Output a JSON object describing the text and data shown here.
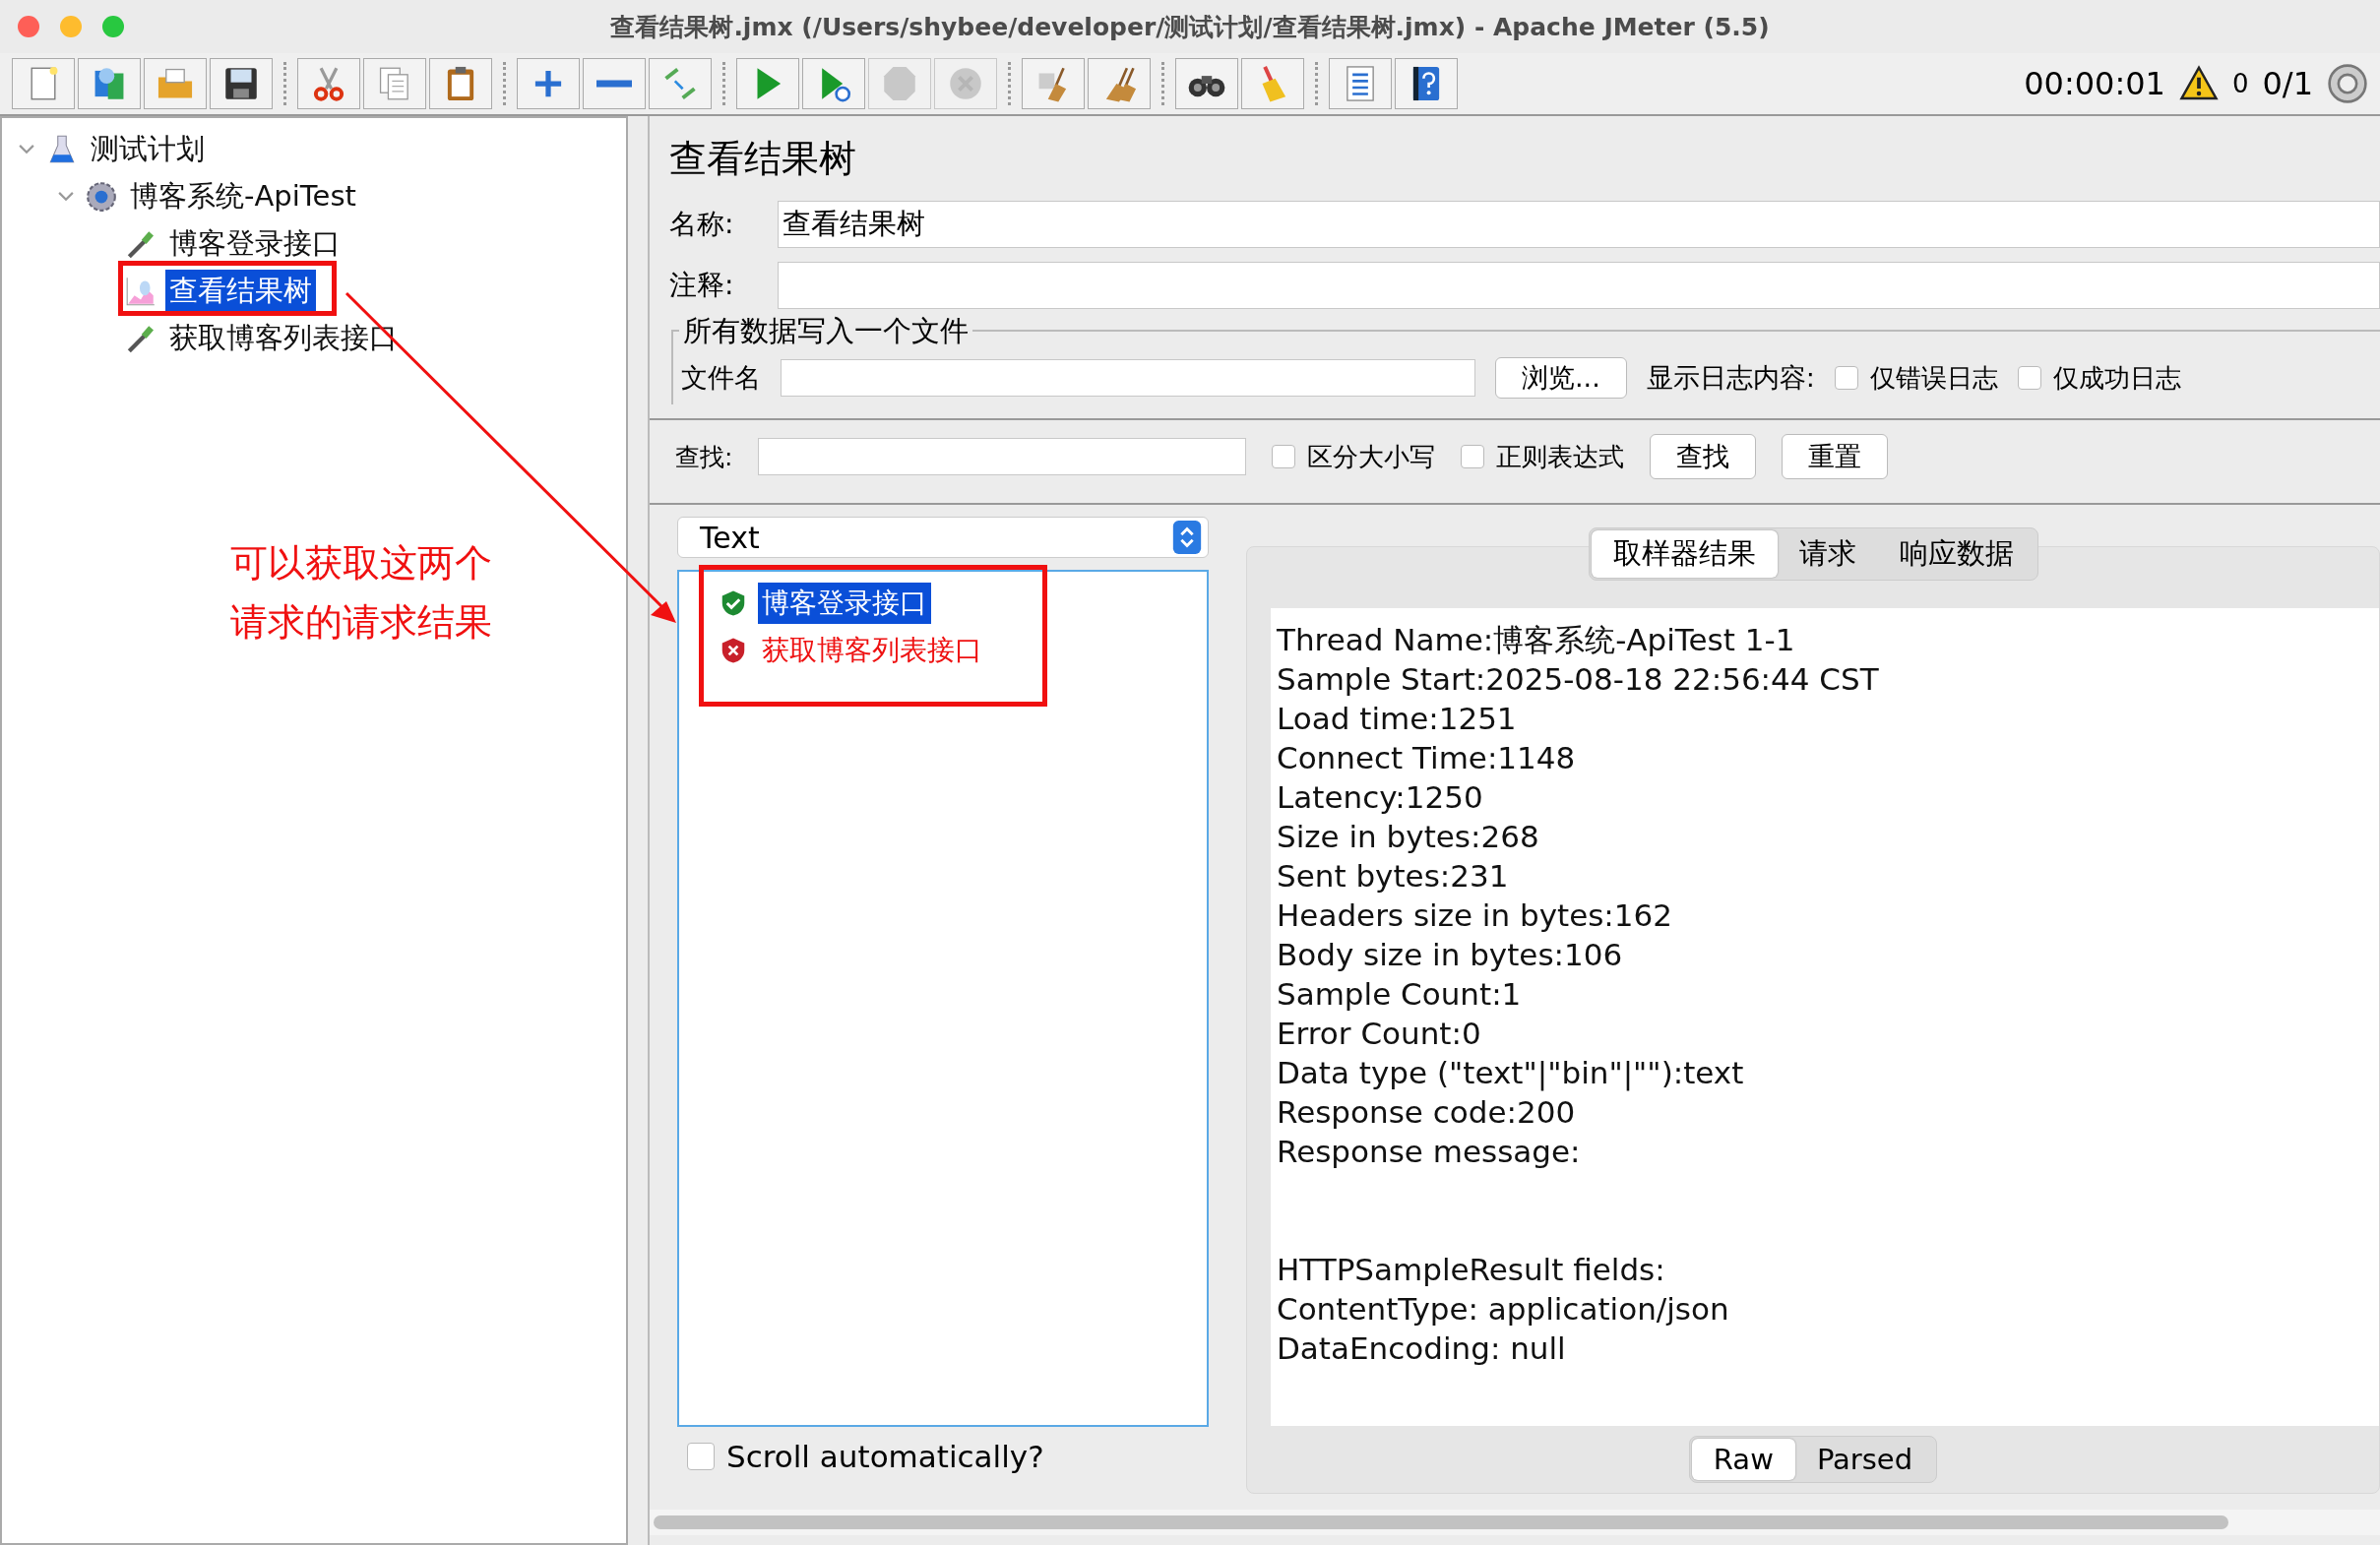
{
  "window": {
    "title": "查看结果树.jmx (/Users/shybee/developer/测试计划/查看结果树.jmx) - Apache JMeter (5.5)"
  },
  "toolbar": [
    [
      {
        "kind": "new",
        "disabled": false
      },
      {
        "kind": "templates",
        "disabled": false
      },
      {
        "kind": "open",
        "disabled": false
      },
      {
        "kind": "save",
        "disabled": false
      }
    ],
    [
      {
        "kind": "cut",
        "disabled": false
      },
      {
        "kind": "copy",
        "disabled": false
      },
      {
        "kind": "paste",
        "disabled": false
      }
    ],
    [
      {
        "kind": "add",
        "disabled": false
      },
      {
        "kind": "remove",
        "disabled": false
      },
      {
        "kind": "toggle",
        "disabled": false
      }
    ],
    [
      {
        "kind": "start",
        "disabled": false
      },
      {
        "kind": "start-no-pause",
        "disabled": false
      },
      {
        "kind": "stop",
        "disabled": true
      },
      {
        "kind": "shutdown",
        "disabled": true
      }
    ],
    [
      {
        "kind": "clear",
        "disabled": false
      },
      {
        "kind": "clear-all",
        "disabled": false
      }
    ],
    [
      {
        "kind": "search",
        "disabled": false
      },
      {
        "kind": "reset-search",
        "disabled": false
      }
    ],
    [
      {
        "kind": "functions",
        "disabled": false
      },
      {
        "kind": "help",
        "disabled": false
      }
    ]
  ],
  "status": {
    "timer": "00:00:01",
    "warnings": "0",
    "threads": "0/1"
  },
  "tree": [
    {
      "label": "测试计划",
      "kind": "plan",
      "selected": false,
      "expanded": true,
      "children": [
        {
          "label": "博客系统-ApiTest",
          "kind": "thread_group",
          "selected": false,
          "expanded": true,
          "children": [
            {
              "label": "博客登录接口",
              "kind": "sampler",
              "selected": false
            },
            {
              "label": "查看结果树",
              "kind": "listener",
              "selected": true
            },
            {
              "label": "获取博客列表接口",
              "kind": "sampler",
              "selected": false
            }
          ]
        }
      ]
    }
  ],
  "form": {
    "heading": "查看结果树",
    "name_label": "名称:",
    "name_value": "查看结果树",
    "comment_label": "注释:",
    "file_section": {
      "legend": "所有数据写入一个文件",
      "file_label": "文件名",
      "browse_button": "浏览...",
      "log_label": "显示日志内容:",
      "options": [
        {
          "label": "仅错误日志",
          "checked": false
        },
        {
          "label": "仅成功日志",
          "checked": false
        }
      ]
    }
  },
  "search": {
    "label": "查找:",
    "options": [
      {
        "label": "区分大小写",
        "checked": false
      },
      {
        "label": "正则表达式",
        "checked": false
      }
    ],
    "buttons": [
      "查找",
      "重置"
    ]
  },
  "results": {
    "renderer": "Text",
    "items": [
      {
        "label": "博客登录接口",
        "kind": "success",
        "selected": true
      },
      {
        "label": "获取博客列表接口",
        "kind": "error",
        "selected": false
      }
    ],
    "scroll_auto": {
      "label": "Scroll automatically?",
      "checked": false
    }
  },
  "detail": {
    "tabs": [
      {
        "label": "取样器结果",
        "selected": true
      },
      {
        "label": "请求",
        "selected": false
      },
      {
        "label": "响应数据",
        "selected": false
      }
    ],
    "blocks": [
      [
        "Thread Name:博客系统-ApiTest 1-1",
        "Sample Start:2025-08-18 22:56:44 CST",
        "Load time:1251",
        "Connect Time:1148",
        "Latency:1250",
        "Size in bytes:268",
        "Sent bytes:231",
        "Headers size in bytes:162",
        "Body size in bytes:106",
        "Sample Count:1",
        "Error Count:0",
        "Data type (\"text\"|\"bin\"|\"\"):text",
        "Response code:200",
        "Response message:"
      ],
      [
        "HTTPSampleResult fields:",
        "ContentType: application/json",
        "DataEncoding: null"
      ]
    ],
    "view_tabs": [
      {
        "label": "Raw",
        "selected": true
      },
      {
        "label": "Parsed",
        "selected": false
      }
    ]
  },
  "annotation": {
    "lines": [
      "可以获取这两个",
      "请求的请求结果"
    ]
  }
}
